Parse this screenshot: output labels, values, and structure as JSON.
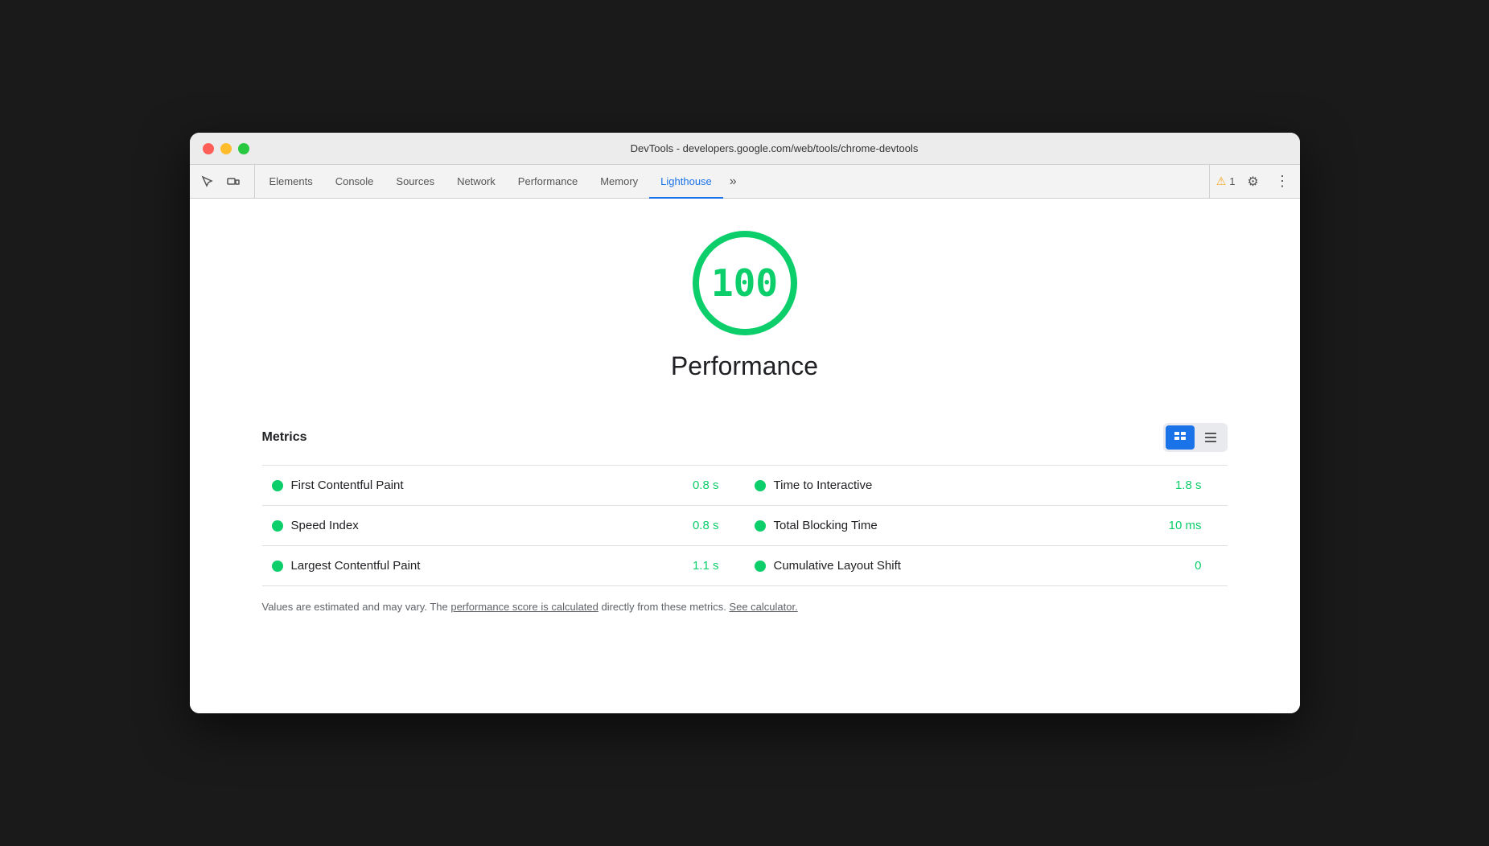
{
  "window": {
    "title": "DevTools - developers.google.com/web/tools/chrome-devtools"
  },
  "toolbar": {
    "tabs": [
      {
        "id": "elements",
        "label": "Elements",
        "active": false
      },
      {
        "id": "console",
        "label": "Console",
        "active": false
      },
      {
        "id": "sources",
        "label": "Sources",
        "active": false
      },
      {
        "id": "network",
        "label": "Network",
        "active": false
      },
      {
        "id": "performance",
        "label": "Performance",
        "active": false
      },
      {
        "id": "memory",
        "label": "Memory",
        "active": false
      },
      {
        "id": "lighthouse",
        "label": "Lighthouse",
        "active": true
      }
    ],
    "more_label": "»",
    "warning_count": "1",
    "settings_icon": "⚙",
    "more_icon": "⋮"
  },
  "lighthouse": {
    "score": "100",
    "panel_title": "Performance",
    "metrics_label": "Metrics",
    "rows": [
      {
        "left_name": "First Contentful Paint",
        "left_value": "0.8 s",
        "right_name": "Time to Interactive",
        "right_value": "1.8 s"
      },
      {
        "left_name": "Speed Index",
        "left_value": "0.8 s",
        "right_name": "Total Blocking Time",
        "right_value": "10 ms"
      },
      {
        "left_name": "Largest Contentful Paint",
        "left_value": "1.1 s",
        "right_name": "Cumulative Layout Shift",
        "right_value": "0"
      }
    ],
    "footer_text_1": "Values are estimated and may vary. The ",
    "footer_link_1": "performance score is calculated",
    "footer_text_2": " directly from these metrics. ",
    "footer_link_2": "See calculator.",
    "toggle_grid_icon": "≡",
    "toggle_list_icon": "☰"
  },
  "colors": {
    "green": "#0cce6b",
    "blue_active": "#1a73e8",
    "warning_yellow": "#f5a623"
  }
}
